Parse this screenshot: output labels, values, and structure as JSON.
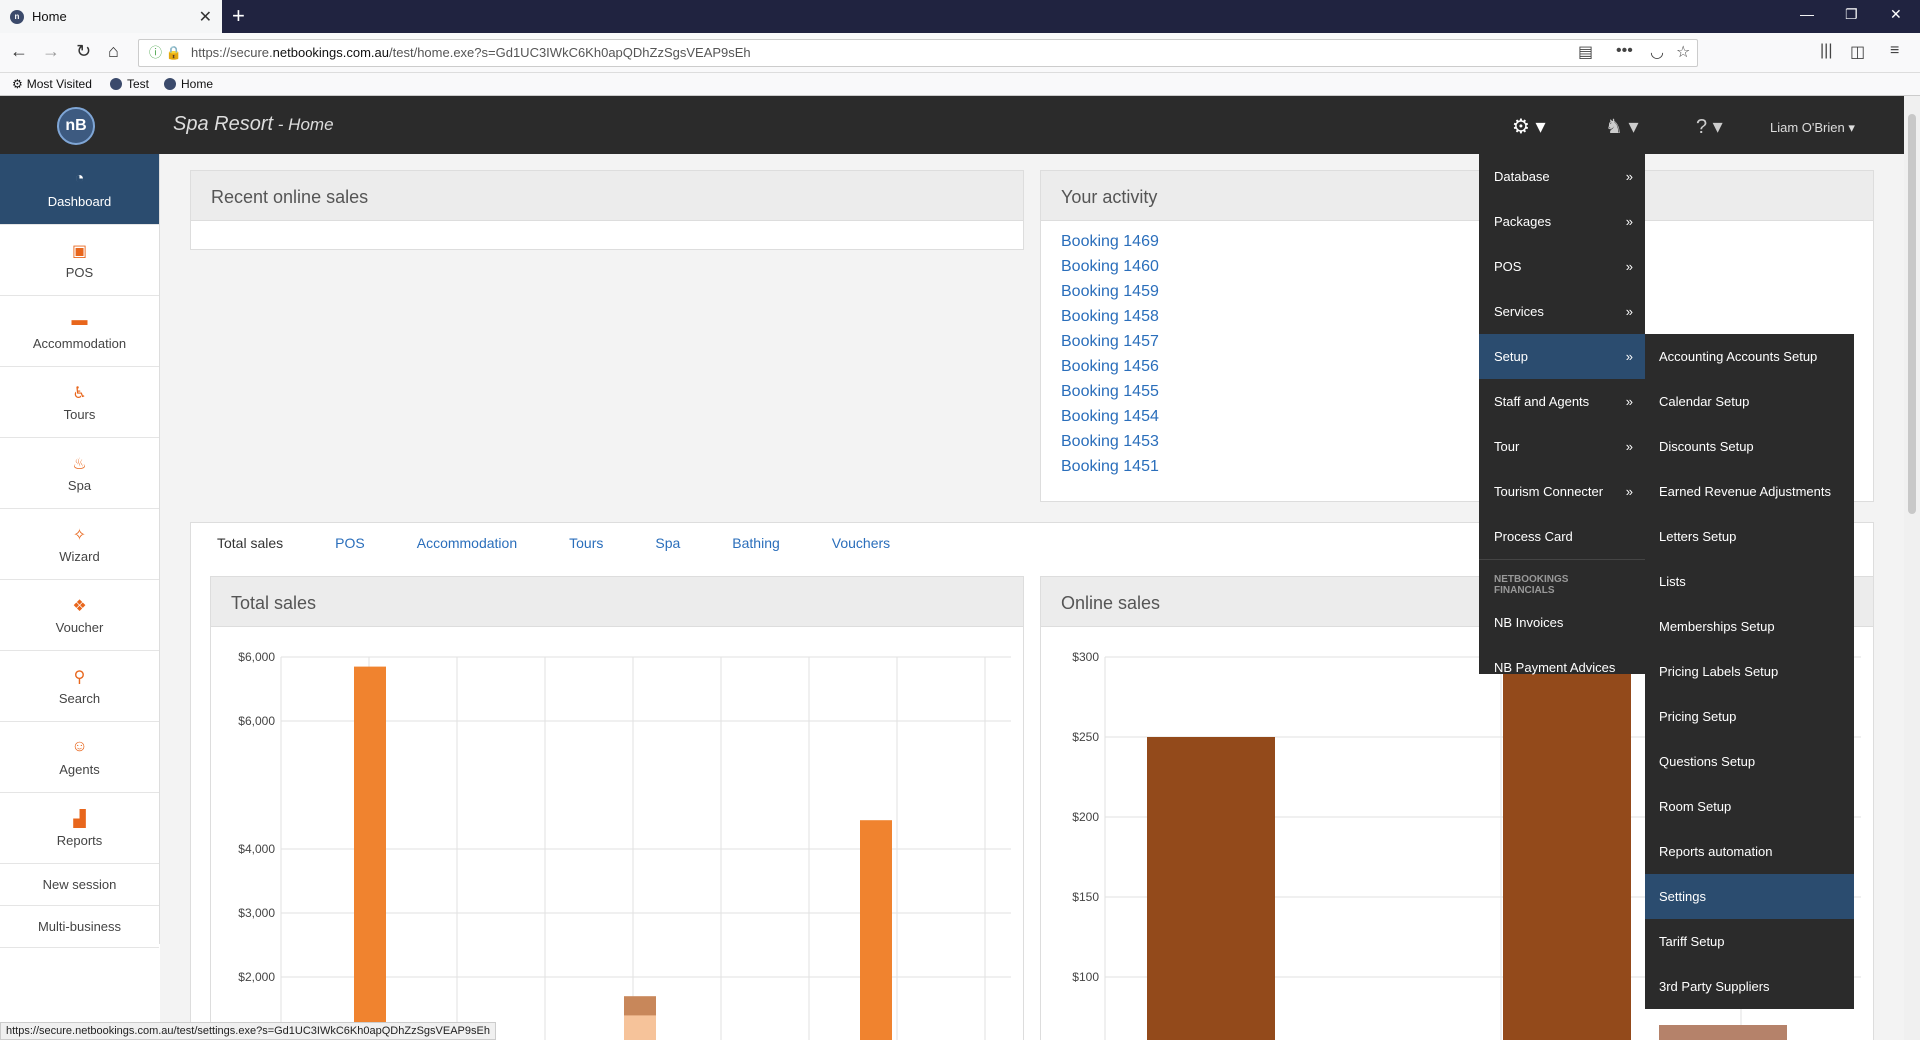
{
  "browser": {
    "tab_title": "Home",
    "url_prefix": "https://secure.",
    "url_domain": "netbookings.com.au",
    "url_path": "/test/home.exe?s=Gd1UC3IWkC6Kh0apQDhZzSgsVEAP9sEh",
    "bookmarks": [
      "Most Visited",
      "Test",
      "Home"
    ],
    "status_url": "https://secure.netbookings.com.au/test/settings.exe?s=Gd1UC3IWkC6Kh0apQDhZzSgsVEAP9sEh"
  },
  "header": {
    "logo_text": "nB",
    "business": "Spa Resort",
    "separator": " - ",
    "page": "Home",
    "user": "Liam O'Brien"
  },
  "sidebar": {
    "items": [
      {
        "label": "Dashboard",
        "icon": "dashboard-icon"
      },
      {
        "label": "POS",
        "icon": "pos-icon"
      },
      {
        "label": "Accommodation",
        "icon": "bed-icon"
      },
      {
        "label": "Tours",
        "icon": "tours-icon"
      },
      {
        "label": "Spa",
        "icon": "spa-icon"
      },
      {
        "label": "Wizard",
        "icon": "wand-icon"
      },
      {
        "label": "Voucher",
        "icon": "gift-icon"
      },
      {
        "label": "Search",
        "icon": "search-icon"
      },
      {
        "label": "Agents",
        "icon": "agent-icon"
      },
      {
        "label": "Reports",
        "icon": "chart-icon"
      }
    ],
    "text_items": [
      "New session",
      "Multi-business"
    ]
  },
  "panels": {
    "recent_sales_title": "Recent online sales",
    "activity_title": "Your activity",
    "activity": [
      "Booking 1469",
      "Booking 1460",
      "Booking 1459",
      "Booking 1458",
      "Booking 1457",
      "Booking 1456",
      "Booking 1455",
      "Booking 1454",
      "Booking 1453",
      "Booking 1451"
    ],
    "total_sales_title": "Total sales",
    "online_sales_title": "Online sales"
  },
  "content_tabs": [
    "Total sales",
    "POS",
    "Accommodation",
    "Tours",
    "Spa",
    "Bathing",
    "Vouchers"
  ],
  "settings_menu": {
    "items": [
      {
        "label": "Database",
        "arrow": "»"
      },
      {
        "label": "Packages",
        "arrow": "»"
      },
      {
        "label": "POS",
        "arrow": "»"
      },
      {
        "label": "Services",
        "arrow": "»"
      },
      {
        "label": "Setup",
        "arrow": "»"
      },
      {
        "label": "Staff and Agents",
        "arrow": "»"
      },
      {
        "label": "Tour",
        "arrow": "»"
      },
      {
        "label": "Tourism Connecter",
        "arrow": "»"
      },
      {
        "label": "Process Card",
        "arrow": ""
      }
    ],
    "section_label": "NETBOOKINGS FINANCIALS",
    "financial_items": [
      "NB Invoices",
      "NB Payment Advices"
    ]
  },
  "setup_submenu": [
    "Accounting Accounts Setup",
    "Calendar Setup",
    "Discounts Setup",
    "Earned Revenue Adjustments",
    "Letters Setup",
    "Lists",
    "Memberships Setup",
    "Pricing Labels Setup",
    "Pricing Setup",
    "Questions Setup",
    "Room Setup",
    "Reports automation",
    "Settings",
    "Tariff Setup",
    "3rd Party Suppliers"
  ],
  "chart_data": [
    {
      "type": "bar",
      "ticks": [
        "$6,000",
        "$6,000",
        "$4,000",
        "$3,000",
        "$2,000"
      ],
      "tick_values": [
        7000,
        6000,
        4000,
        3000,
        2000
      ],
      "ylim": [
        1000,
        7000
      ],
      "bars": [
        {
          "slot": 1,
          "value": 6850,
          "color": "#f0832f"
        },
        {
          "slot": 4,
          "value": 1700,
          "color": "#c8875a"
        },
        {
          "slot": 4,
          "value": 1400,
          "color": "#f6c39a"
        },
        {
          "slot": 7,
          "value": 4450,
          "color": "#f0832f"
        }
      ],
      "slots": 9
    },
    {
      "type": "bar",
      "ticks": [
        "$300",
        "$250",
        "$200",
        "$150",
        "$100"
      ],
      "tick_values": [
        300,
        250,
        200,
        150,
        100
      ],
      "ylim": [
        50,
        300
      ],
      "bars": [
        {
          "slot": 0,
          "value": 250,
          "color": "#934a1b"
        },
        {
          "slot": 1,
          "value": 290,
          "color": "#934a1b"
        },
        {
          "slot": 2,
          "value": 70,
          "color": "#b5826a"
        }
      ]
    }
  ]
}
